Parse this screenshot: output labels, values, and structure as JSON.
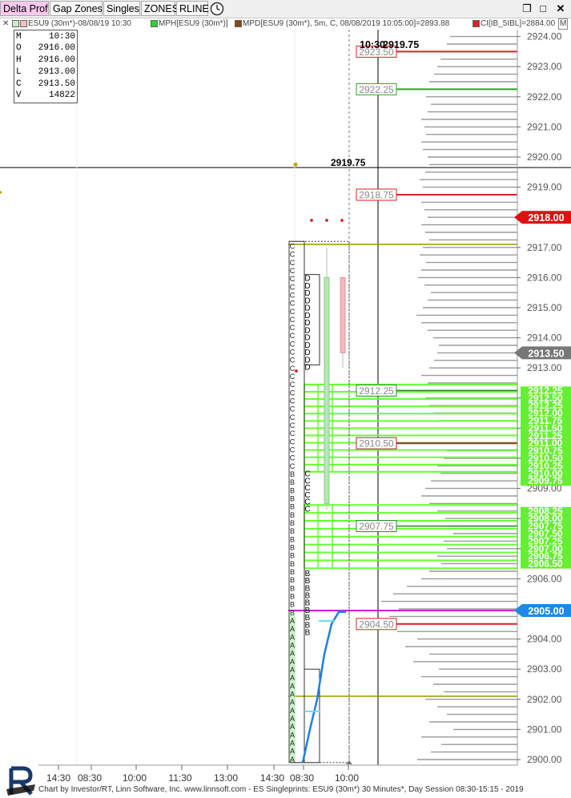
{
  "toolbar": {
    "buttons": [
      "Delta Prof",
      "Gap Zones",
      "Singles",
      "ZONES",
      "RLINE"
    ],
    "active": "Delta Prof"
  },
  "legend": {
    "items": [
      {
        "text": "ESU9 (30m*)-08/08/19 10:30",
        "color": "#ee8888"
      },
      {
        "text": "MPH[ESU9 (30m*)]",
        "color": "#33cc33"
      },
      {
        "text": "MPD[ESU9 (30m*), 5m, C, 08/08/2019 10:05:00]=2893.88",
        "color": "#8b4513"
      },
      {
        "text": "CI[IB_5IBL]=2884.00",
        "color": "#dd2222"
      }
    ],
    "m_label": "M"
  },
  "ohlc": [
    {
      "k": "M",
      "v": "10:30"
    },
    {
      "k": "O",
      "v": "2916.00"
    },
    {
      "k": "H",
      "v": "2916.00"
    },
    {
      "k": "L",
      "v": "2913.00"
    },
    {
      "k": "C",
      "v": "2913.50"
    },
    {
      "k": "V",
      "v": "14822"
    }
  ],
  "header_price": {
    "time": "10:30",
    "price": "2919.75",
    "left_price": "2919.75"
  },
  "chart_data": {
    "type": "market-profile",
    "yaxis": {
      "min": 2900,
      "max": 2924,
      "ticks": [
        "2900.00",
        "2901.00",
        "2902.00",
        "2903.00",
        "2904.00",
        "2905.00",
        "2906.00",
        "2907.00",
        "2908.00",
        "2909.00",
        "2910.00",
        "2911.00",
        "2912.00",
        "2913.00",
        "2914.00",
        "2915.00",
        "2916.00",
        "2917.00",
        "2918.00",
        "2919.00",
        "2920.00",
        "2921.00",
        "2922.00",
        "2923.00",
        "2924.00"
      ]
    },
    "xaxis": {
      "ticks": [
        "14:30",
        "08:30",
        "10:00",
        "11:30",
        "13:00",
        "14:30",
        "08:30",
        "10:00"
      ]
    },
    "boxed_levels": [
      {
        "price": 2923.5,
        "label": "2923.50",
        "color": "#dd2222",
        "kind": "red"
      },
      {
        "price": 2922.25,
        "label": "2922.25",
        "color": "#22aa22",
        "kind": "green"
      },
      {
        "price": 2918.75,
        "label": "2918.75",
        "color": "#dd2222",
        "kind": "red"
      },
      {
        "price": 2912.25,
        "label": "2912.25",
        "color": "#228822",
        "kind": "green"
      },
      {
        "price": 2910.5,
        "label": "2910.50",
        "color": "#b22222",
        "kind": "red"
      },
      {
        "price": 2907.75,
        "label": "2907.75",
        "color": "#228822",
        "kind": "green"
      },
      {
        "price": 2904.5,
        "label": "2904.50",
        "color": "#dd2222",
        "kind": "red"
      }
    ],
    "olive_levels": [
      2917.1,
      2902.1
    ],
    "magenta_level": 2905.0,
    "axis_tags": [
      {
        "price": 2918.0,
        "label": "2918.00",
        "color": "#dd1111"
      },
      {
        "price": 2913.5,
        "label": "2913.50",
        "color": "#777777"
      },
      {
        "price": 2905.0,
        "label": "2905.00",
        "color": "#1e88e5"
      }
    ],
    "green_zone_upper": [
      "2912.25",
      "2912.50",
      "2912.25",
      "2912.00",
      "2911.75",
      "2911.50",
      "2911.25",
      "2911.00",
      "2910.75",
      "2910.50",
      "2910.25",
      "2910.00",
      "2909.75"
    ],
    "green_zone_lower": [
      "2908.25",
      "2908.00",
      "2907.75",
      "2907.50",
      "2907.25",
      "2907.00",
      "2906.75",
      "2906.50"
    ],
    "profile_letters": {
      "col1": "AAAAAAAAAAAAAAAAAABBBBBBBBBBBBBBBBBBCCCCCCCCCCCCCCCCCCCCCCCCCCCC",
      "col2_b": "BBBBBBBBB",
      "col2_c": "CCCCCC",
      "col2_d": "DDDDDDDDDDDDD"
    },
    "volume_profile": [
      [
        2900.0,
        125
      ],
      [
        2900.25,
        108
      ],
      [
        2900.5,
        95
      ],
      [
        2900.75,
        120
      ],
      [
        2901.0,
        80
      ],
      [
        2901.25,
        110
      ],
      [
        2901.5,
        88
      ],
      [
        2901.75,
        100
      ],
      [
        2902.0,
        115
      ],
      [
        2902.25,
        92
      ],
      [
        2902.5,
        105
      ],
      [
        2902.75,
        120
      ],
      [
        2903.0,
        98
      ],
      [
        2903.25,
        130
      ],
      [
        2903.5,
        110
      ],
      [
        2903.75,
        140
      ],
      [
        2904.0,
        125
      ],
      [
        2904.25,
        150
      ],
      [
        2904.5,
        135
      ],
      [
        2904.75,
        160
      ],
      [
        2905.0,
        148
      ],
      [
        2905.25,
        170
      ],
      [
        2905.5,
        155
      ],
      [
        2905.75,
        138
      ],
      [
        2906.0,
        120
      ],
      [
        2906.25,
        110
      ],
      [
        2906.5,
        95
      ],
      [
        2906.75,
        100
      ],
      [
        2907.0,
        88
      ],
      [
        2907.25,
        92
      ],
      [
        2907.5,
        80
      ],
      [
        2907.75,
        86
      ],
      [
        2908.0,
        90
      ],
      [
        2908.25,
        100
      ],
      [
        2908.5,
        110
      ],
      [
        2908.75,
        120
      ],
      [
        2909.0,
        115
      ],
      [
        2909.25,
        108
      ],
      [
        2909.5,
        96
      ],
      [
        2909.75,
        100
      ],
      [
        2910.0,
        92
      ],
      [
        2910.25,
        88
      ],
      [
        2910.5,
        85
      ],
      [
        2910.75,
        90
      ],
      [
        2911.0,
        96
      ],
      [
        2911.25,
        100
      ],
      [
        2911.5,
        105
      ],
      [
        2911.75,
        110
      ],
      [
        2912.0,
        115
      ],
      [
        2912.25,
        118
      ],
      [
        2912.5,
        112
      ],
      [
        2912.75,
        120
      ],
      [
        2913.0,
        110
      ],
      [
        2913.25,
        104
      ],
      [
        2913.5,
        100
      ],
      [
        2913.75,
        98
      ],
      [
        2914.0,
        105
      ],
      [
        2914.25,
        112
      ],
      [
        2914.5,
        120
      ],
      [
        2914.75,
        126
      ],
      [
        2915.0,
        118
      ],
      [
        2915.25,
        112
      ],
      [
        2915.5,
        108
      ],
      [
        2915.75,
        116
      ],
      [
        2916.0,
        124
      ],
      [
        2916.25,
        120
      ],
      [
        2916.5,
        114
      ],
      [
        2916.75,
        122
      ],
      [
        2917.0,
        118
      ],
      [
        2917.25,
        110
      ],
      [
        2917.5,
        115
      ],
      [
        2917.75,
        120
      ],
      [
        2918.0,
        112
      ],
      [
        2918.25,
        116
      ],
      [
        2918.5,
        120
      ],
      [
        2918.75,
        124
      ],
      [
        2919.0,
        118
      ],
      [
        2919.25,
        122
      ],
      [
        2919.5,
        115
      ],
      [
        2919.75,
        110
      ],
      [
        2920.0,
        112
      ],
      [
        2920.25,
        118
      ],
      [
        2920.5,
        120
      ],
      [
        2920.75,
        114
      ],
      [
        2921.0,
        116
      ],
      [
        2921.25,
        120
      ],
      [
        2921.5,
        112
      ],
      [
        2921.75,
        108
      ],
      [
        2922.0,
        114
      ],
      [
        2922.25,
        118
      ],
      [
        2922.5,
        110
      ],
      [
        2922.75,
        104
      ],
      [
        2923.0,
        100
      ],
      [
        2923.25,
        96
      ],
      [
        2923.5,
        92
      ],
      [
        2923.75,
        88
      ],
      [
        2924.0,
        84
      ]
    ],
    "candles": [
      {
        "o": 2913.5,
        "c": 2916.0,
        "h": 2916.0,
        "l": 2913.0,
        "color": "#f4b8b8"
      },
      {
        "o": 2908.5,
        "c": 2916.0,
        "h": 2917.0,
        "l": 2908.3,
        "color": "#b8e6b8"
      }
    ],
    "blue_line": [
      [
        2899.9,
        0
      ],
      [
        2901.0,
        1
      ],
      [
        2902.0,
        2
      ],
      [
        2903.5,
        3
      ],
      [
        2904.5,
        4
      ],
      [
        2904.9,
        5
      ],
      [
        2904.9,
        6
      ]
    ]
  },
  "footer": "Chart by Investor/RT, Linn Software, Inc. www.linnsoft.com - ES Singleprints: ESU9 (30m*) 30 Minutes*, Day Session 08:30-15:15 - 2019",
  "colors": {
    "green_zone": "#66ff33",
    "green_dark": "#33aa11",
    "red_level": "#dd2222",
    "magenta": "#cc22cc",
    "olive": "#999900",
    "axis_bg": "#ffffff",
    "profile_bar": "#9a9a9a"
  }
}
